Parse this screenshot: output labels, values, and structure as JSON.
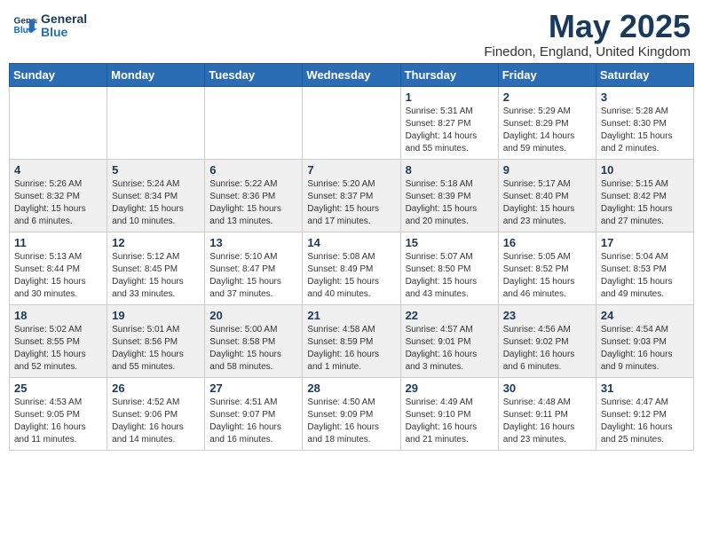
{
  "header": {
    "logo_line1": "General",
    "logo_line2": "Blue",
    "month_title": "May 2025",
    "location": "Finedon, England, United Kingdom"
  },
  "weekdays": [
    "Sunday",
    "Monday",
    "Tuesday",
    "Wednesday",
    "Thursday",
    "Friday",
    "Saturday"
  ],
  "weeks": [
    [
      {
        "day": "",
        "info": ""
      },
      {
        "day": "",
        "info": ""
      },
      {
        "day": "",
        "info": ""
      },
      {
        "day": "",
        "info": ""
      },
      {
        "day": "1",
        "info": "Sunrise: 5:31 AM\nSunset: 8:27 PM\nDaylight: 14 hours\nand 55 minutes."
      },
      {
        "day": "2",
        "info": "Sunrise: 5:29 AM\nSunset: 8:29 PM\nDaylight: 14 hours\nand 59 minutes."
      },
      {
        "day": "3",
        "info": "Sunrise: 5:28 AM\nSunset: 8:30 PM\nDaylight: 15 hours\nand 2 minutes."
      }
    ],
    [
      {
        "day": "4",
        "info": "Sunrise: 5:26 AM\nSunset: 8:32 PM\nDaylight: 15 hours\nand 6 minutes."
      },
      {
        "day": "5",
        "info": "Sunrise: 5:24 AM\nSunset: 8:34 PM\nDaylight: 15 hours\nand 10 minutes."
      },
      {
        "day": "6",
        "info": "Sunrise: 5:22 AM\nSunset: 8:36 PM\nDaylight: 15 hours\nand 13 minutes."
      },
      {
        "day": "7",
        "info": "Sunrise: 5:20 AM\nSunset: 8:37 PM\nDaylight: 15 hours\nand 17 minutes."
      },
      {
        "day": "8",
        "info": "Sunrise: 5:18 AM\nSunset: 8:39 PM\nDaylight: 15 hours\nand 20 minutes."
      },
      {
        "day": "9",
        "info": "Sunrise: 5:17 AM\nSunset: 8:40 PM\nDaylight: 15 hours\nand 23 minutes."
      },
      {
        "day": "10",
        "info": "Sunrise: 5:15 AM\nSunset: 8:42 PM\nDaylight: 15 hours\nand 27 minutes."
      }
    ],
    [
      {
        "day": "11",
        "info": "Sunrise: 5:13 AM\nSunset: 8:44 PM\nDaylight: 15 hours\nand 30 minutes."
      },
      {
        "day": "12",
        "info": "Sunrise: 5:12 AM\nSunset: 8:45 PM\nDaylight: 15 hours\nand 33 minutes."
      },
      {
        "day": "13",
        "info": "Sunrise: 5:10 AM\nSunset: 8:47 PM\nDaylight: 15 hours\nand 37 minutes."
      },
      {
        "day": "14",
        "info": "Sunrise: 5:08 AM\nSunset: 8:49 PM\nDaylight: 15 hours\nand 40 minutes."
      },
      {
        "day": "15",
        "info": "Sunrise: 5:07 AM\nSunset: 8:50 PM\nDaylight: 15 hours\nand 43 minutes."
      },
      {
        "day": "16",
        "info": "Sunrise: 5:05 AM\nSunset: 8:52 PM\nDaylight: 15 hours\nand 46 minutes."
      },
      {
        "day": "17",
        "info": "Sunrise: 5:04 AM\nSunset: 8:53 PM\nDaylight: 15 hours\nand 49 minutes."
      }
    ],
    [
      {
        "day": "18",
        "info": "Sunrise: 5:02 AM\nSunset: 8:55 PM\nDaylight: 15 hours\nand 52 minutes."
      },
      {
        "day": "19",
        "info": "Sunrise: 5:01 AM\nSunset: 8:56 PM\nDaylight: 15 hours\nand 55 minutes."
      },
      {
        "day": "20",
        "info": "Sunrise: 5:00 AM\nSunset: 8:58 PM\nDaylight: 15 hours\nand 58 minutes."
      },
      {
        "day": "21",
        "info": "Sunrise: 4:58 AM\nSunset: 8:59 PM\nDaylight: 16 hours\nand 1 minute."
      },
      {
        "day": "22",
        "info": "Sunrise: 4:57 AM\nSunset: 9:01 PM\nDaylight: 16 hours\nand 3 minutes."
      },
      {
        "day": "23",
        "info": "Sunrise: 4:56 AM\nSunset: 9:02 PM\nDaylight: 16 hours\nand 6 minutes."
      },
      {
        "day": "24",
        "info": "Sunrise: 4:54 AM\nSunset: 9:03 PM\nDaylight: 16 hours\nand 9 minutes."
      }
    ],
    [
      {
        "day": "25",
        "info": "Sunrise: 4:53 AM\nSunset: 9:05 PM\nDaylight: 16 hours\nand 11 minutes."
      },
      {
        "day": "26",
        "info": "Sunrise: 4:52 AM\nSunset: 9:06 PM\nDaylight: 16 hours\nand 14 minutes."
      },
      {
        "day": "27",
        "info": "Sunrise: 4:51 AM\nSunset: 9:07 PM\nDaylight: 16 hours\nand 16 minutes."
      },
      {
        "day": "28",
        "info": "Sunrise: 4:50 AM\nSunset: 9:09 PM\nDaylight: 16 hours\nand 18 minutes."
      },
      {
        "day": "29",
        "info": "Sunrise: 4:49 AM\nSunset: 9:10 PM\nDaylight: 16 hours\nand 21 minutes."
      },
      {
        "day": "30",
        "info": "Sunrise: 4:48 AM\nSunset: 9:11 PM\nDaylight: 16 hours\nand 23 minutes."
      },
      {
        "day": "31",
        "info": "Sunrise: 4:47 AM\nSunset: 9:12 PM\nDaylight: 16 hours\nand 25 minutes."
      }
    ]
  ]
}
